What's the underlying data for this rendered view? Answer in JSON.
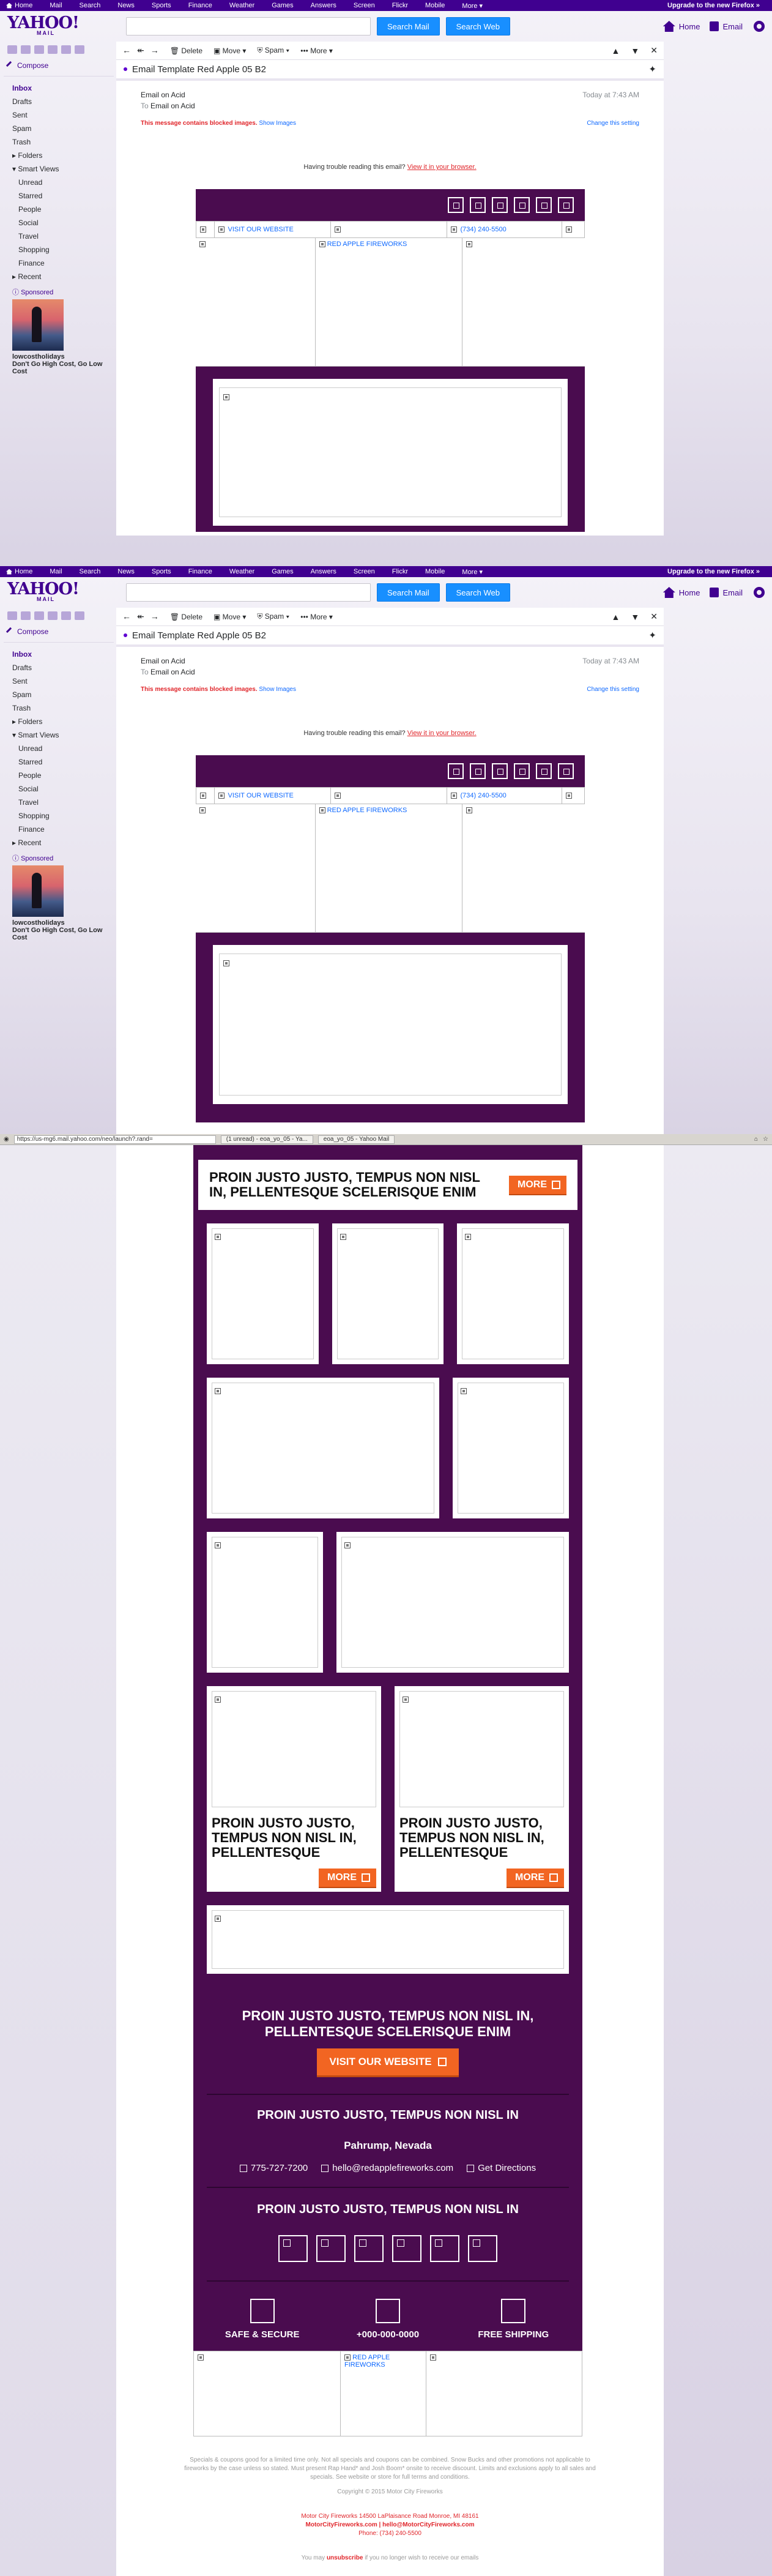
{
  "topnav": {
    "items": [
      "Home",
      "Mail",
      "Search",
      "News",
      "Sports",
      "Finance",
      "Weather",
      "Games",
      "Answers",
      "Screen",
      "Flickr",
      "Mobile",
      "More ▾"
    ],
    "upgrade": "Upgrade to the new Firefox »"
  },
  "header": {
    "logo": "YAHOO!",
    "logo_sub": "MAIL",
    "search_mail": "Search Mail",
    "search_web": "Search Web",
    "home": "Home",
    "email": "Email"
  },
  "sidebar": {
    "compose": "Compose",
    "folders_main": [
      "Inbox",
      "Drafts",
      "Sent",
      "Spam",
      "Trash"
    ],
    "folders_label": "Folders",
    "smart_views_label": "Smart Views",
    "smart_views": [
      "Unread",
      "Starred",
      "People",
      "Social",
      "Travel",
      "Shopping",
      "Finance"
    ],
    "recent_label": "Recent",
    "sponsored_label": "Sponsored",
    "ad_name": "lowcostholidays",
    "ad_text": "Don't Go High Cost, Go Low Cost"
  },
  "toolbar": {
    "delete": "Delete",
    "move": "Move",
    "spam": "Spam",
    "more": "More"
  },
  "message": {
    "tab_title": "Email Template Red Apple 05 B2",
    "from": "Email on Acid",
    "time": "Today at 7:43 AM",
    "to_label": "To",
    "to": "Email on Acid",
    "blocked": "This message contains blocked images.",
    "show_images": "Show Images",
    "change_setting": "Change this setting",
    "trouble": "Having trouble reading this email?",
    "view_browser": "View it in your browser."
  },
  "email": {
    "nav_website": "VISIT OUR WEBSITE",
    "nav_phone": "(734) 240-5500",
    "fireworks_link": "RED APPLE FIREWORKS",
    "banner_heading": "PROIN JUSTO JUSTO, TEMPUS NON NISL IN, PELLENTESQUE SCELERISQUE ENIM",
    "more": "MORE",
    "promo_heading": "PROIN JUSTO JUSTO, TEMPUS NON NISL IN, PELLENTESQUE",
    "cta_heading": "PROIN JUSTO JUSTO, TEMPUS NON NISL IN, PELLENTESQUE SCELERISQUE ENIM",
    "cta_button": "VISIT OUR WEBSITE",
    "location_heading": "PROIN JUSTO JUSTO, TEMPUS NON NISL IN",
    "city": "Pahrump, Nevada",
    "phone": "775-727-7200",
    "email_address": "hello@redapplefireworks.com",
    "directions": "Get Directions",
    "follow_heading": "PROIN JUSTO JUSTO, TEMPUS NON NISL IN",
    "badge1": "SAFE & SECURE",
    "badge2": "+000-000-0000",
    "badge3": "FREE SHIPPING",
    "legal1": "Specials & coupons good for a limited time only. Not all specials and coupons can be combined. Snow Bucks and other promotions not applicable to fireworks by the case unless so stated. Must present Rap Hand* and Josh Boom* onsite to receive discount. Limits and exclusions apply to all sales and specials. See website or store for full terms and conditions.",
    "copyright": "Copyright © 2015 Motor City Fireworks",
    "address": "Motor City Fireworks 14500 LaPlaisance Road Monroe, MI 48161",
    "footer_links": "MotorCityFireworks.com | hello@MotorCityFireworks.com",
    "footer_phone": "Phone: (734) 240-5500",
    "unsub_pre": "You may",
    "unsub_link": "unsubscribe",
    "unsub_post": "if you no longer wish to receive our emails"
  },
  "firefox_bar": {
    "url": "https://us-mg6.mail.yahoo.com/neo/launch?.rand=",
    "tab1": "(1 unread) - eoa_yo_05 - Ya...",
    "tab2": "eoa_yo_05 - Yahoo Mail"
  }
}
